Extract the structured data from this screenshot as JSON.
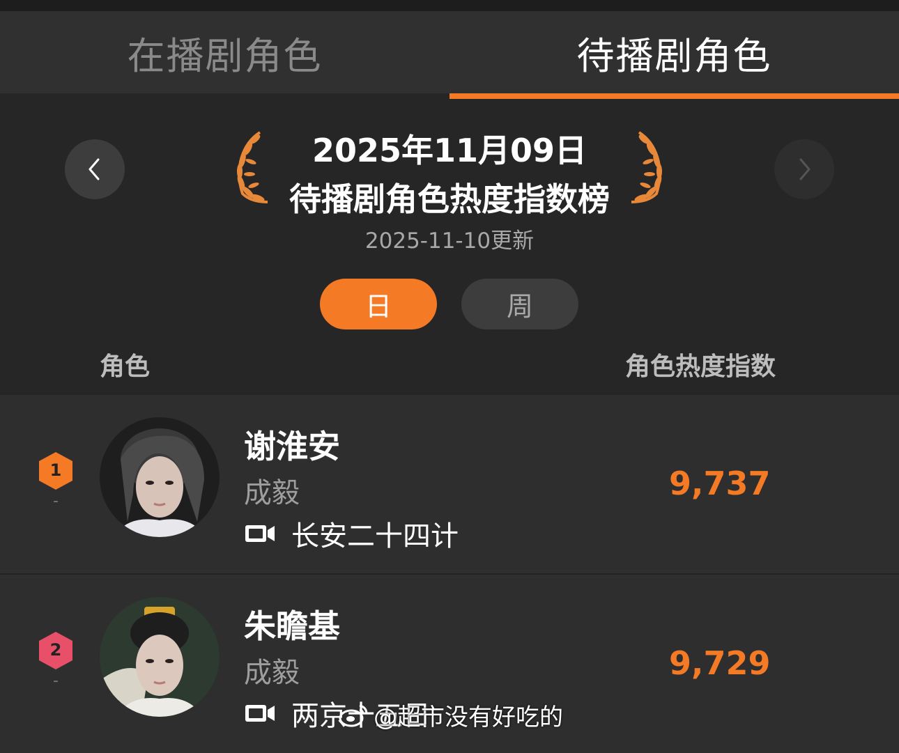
{
  "tabs": [
    {
      "label": "在播剧角色",
      "active": false
    },
    {
      "label": "待播剧角色",
      "active": true
    }
  ],
  "header": {
    "date": "2025年11月09日",
    "title": "待播剧角色热度指数榜",
    "updated": "2025-11-10更新"
  },
  "period": {
    "day_label": "日",
    "week_label": "周",
    "selected": "日"
  },
  "columns": {
    "role": "角色",
    "index": "角色热度指数"
  },
  "rows": [
    {
      "rank": "1",
      "rank_change": "-",
      "character": "谢淮安",
      "actor": "成毅",
      "show": "长安二十四计",
      "score": "9,737",
      "badge_color": "#f47a26"
    },
    {
      "rank": "2",
      "rank_change": "-",
      "character": "朱瞻基",
      "actor": "成毅",
      "show": "两京十五日",
      "score": "9,729",
      "badge_color": "#e8506a"
    }
  ],
  "watermark": {
    "text": "@超市没有好吃的"
  },
  "colors": {
    "accent": "#f47a26",
    "background": "#262626",
    "row": "#2e2e2e"
  }
}
